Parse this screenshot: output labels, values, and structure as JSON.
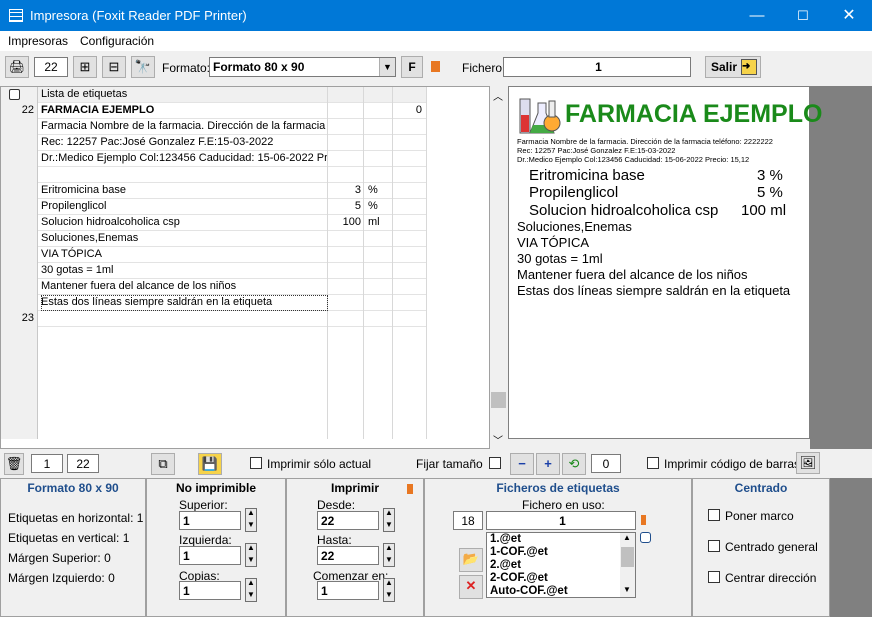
{
  "window": {
    "title": "Impresora (Foxit Reader PDF Printer)"
  },
  "menu": {
    "items": [
      "Impresoras",
      "Configuración"
    ]
  },
  "toolbar": {
    "count": "22",
    "formato_label": "Formato:",
    "formato_value": "Formato 80 x 90",
    "f_button": "F",
    "fichero_label": "Fichero:",
    "fichero_value": "1",
    "salir_label": "Salir"
  },
  "grid": {
    "header": "Lista de etiquetas",
    "rows": [
      {
        "num": "22",
        "text": "FARMACIA EJEMPLO",
        "bold": true,
        "val": "",
        "unit": "",
        "ext": "0"
      },
      {
        "num": "",
        "text": "Farmacia Nombre de la farmacia. Dirección de la farmacia te",
        "val": "",
        "unit": "",
        "ext": ""
      },
      {
        "num": "",
        "text": "Rec: 12257 Pac:José Gonzalez F.E:15-03-2022",
        "val": "",
        "unit": "",
        "ext": ""
      },
      {
        "num": "",
        "text": "Dr.:Medico Ejemplo Col:123456 Caducidad: 15-06-2022 Pre",
        "val": "",
        "unit": "",
        "ext": ""
      },
      {
        "num": "",
        "text": "",
        "val": "",
        "unit": "",
        "ext": ""
      },
      {
        "num": "",
        "text": "Eritromicina base",
        "val": "3",
        "unit": "%",
        "ext": ""
      },
      {
        "num": "",
        "text": "Propilenglicol",
        "val": "5",
        "unit": "%",
        "ext": ""
      },
      {
        "num": "",
        "text": "Solucion hidroalcoholica  csp",
        "val": "100",
        "unit": "ml",
        "ext": ""
      },
      {
        "num": "",
        "text": "Soluciones,Enemas",
        "val": "",
        "unit": "",
        "ext": ""
      },
      {
        "num": "",
        "text": "VIA TÓPICA",
        "val": "",
        "unit": "",
        "ext": ""
      },
      {
        "num": "",
        "text": "30 gotas = 1ml",
        "val": "",
        "unit": "",
        "ext": ""
      },
      {
        "num": "",
        "text": "Mantener fuera del alcance de los niños",
        "val": "",
        "unit": "",
        "ext": ""
      },
      {
        "num": "",
        "text": "Estas dos líneas siempre saldrán en la etiqueta",
        "val": "",
        "unit": "",
        "ext": ""
      },
      {
        "num": "23",
        "text": "",
        "val": "",
        "unit": "",
        "ext": ""
      }
    ]
  },
  "preview": {
    "title": "FARMACIA EJEMPLO",
    "line1": "Farmacia Nombre de la farmacia. Dirección de la farmacia teléfono: 2222222",
    "line2": "Rec: 12257 Pac:José Gonzalez F.E:15-03-2022",
    "line3": "Dr.:Medico Ejemplo Col:123456 Caducidad: 15-06-2022 Precio: 15,12",
    "ing1": "Eritromicina base",
    "ing1v": "3 %",
    "ing2": "Propilenglicol",
    "ing2v": "5 %",
    "ing3": "Solucion hidroalcoholica   csp",
    "ing3v": "100 ml",
    "t1": "Soluciones,Enemas",
    "t2": "VIA TÓPICA",
    "t3": "30 gotas = 1ml",
    "t4": "Mantener fuera del alcance de los niños",
    "t5": "Estas dos líneas siempre saldrán en la etiqueta"
  },
  "bottombar": {
    "from": "1",
    "to": "22",
    "imprimir_actual": "Imprimir sólo actual",
    "fijar_tamano": "Fijar tamaño",
    "zoom": "0",
    "imprimir_codigo": "Imprimir código de barras"
  },
  "panel_formato": {
    "title": "Formato 80 x 90",
    "horiz_label": "Etiquetas en horizontal:",
    "horiz": "1",
    "vert_label": "Etiquetas en vertical:",
    "vert": "1",
    "msup_label": "Márgen Superior:",
    "msup": "0",
    "mizq_label": "Márgen  Izquierdo:",
    "mizq": "0"
  },
  "panel_noimp": {
    "title": "No imprimible",
    "superior_label": "Superior:",
    "superior": "1",
    "izquierda_label": "Izquierda:",
    "izquierda": "1",
    "copias_label": "Copias:",
    "copias": "1"
  },
  "panel_imprimir": {
    "title": "Imprimir",
    "desde_label": "Desde:",
    "desde": "22",
    "hasta_label": "Hasta:",
    "hasta": "22",
    "comenzar_label": "Comenzar en:",
    "comenzar": "1"
  },
  "panel_ficheros": {
    "title": "Ficheros de etiquetas",
    "enuso_label": "Fichero en uso:",
    "count": "18",
    "current": "1",
    "files": [
      "1.@et",
      "1-COF.@et",
      "2.@et",
      "2-COF.@et",
      "Auto-COF.@et"
    ]
  },
  "panel_centrado": {
    "title": "Centrado",
    "opt1": "Poner marco",
    "opt2": "Centrado general",
    "opt3": "Centrar dirección"
  },
  "colors": {
    "titlebar": "#0078d7",
    "preview_title": "#1a8a1a",
    "panel_title": "#1f4e8c"
  }
}
